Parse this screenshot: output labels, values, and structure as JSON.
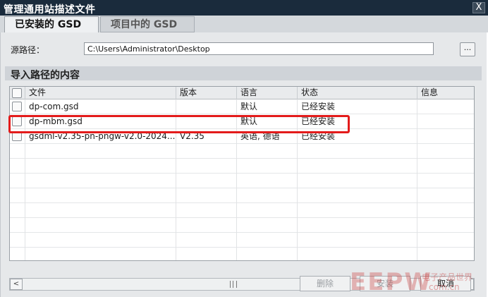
{
  "window": {
    "title": "管理通用站描述文件",
    "close_glyph": "X"
  },
  "tabs": [
    {
      "label": "已安装的 GSD",
      "active": true
    },
    {
      "label": "项目中的 GSD",
      "active": false
    }
  ],
  "source": {
    "label": "源路径：",
    "value": "C:\\Users\\Administrator\\Desktop",
    "browse_label": "..."
  },
  "section": {
    "title": "导入路径的内容"
  },
  "table": {
    "columns": [
      "文件",
      "版本",
      "语言",
      "状态",
      "信息"
    ],
    "rows": [
      {
        "file": "dp-com.gsd",
        "version": "",
        "language": "默认",
        "status": "已经安装",
        "info": ""
      },
      {
        "file": "dp-mbm.gsd",
        "version": "",
        "language": "默认",
        "status": "已经安装",
        "info": ""
      },
      {
        "file": "gsdml-v2.35-pn-pngw-v2.0-2024...",
        "version": "V2.35",
        "language": "英语, 德语",
        "status": "已经安装",
        "info": ""
      }
    ]
  },
  "scrollbar": {
    "left_glyph": "<",
    "right_glyph": ">"
  },
  "buttons": {
    "delete": "删除",
    "install": "安装",
    "cancel": "取消"
  },
  "watermark": {
    "logo": "EEPW",
    "tagline": "电子产品世界",
    "url": "com.cn"
  },
  "colors": {
    "titlebar": "#1a2b3c",
    "highlight": "#e31b1b"
  }
}
